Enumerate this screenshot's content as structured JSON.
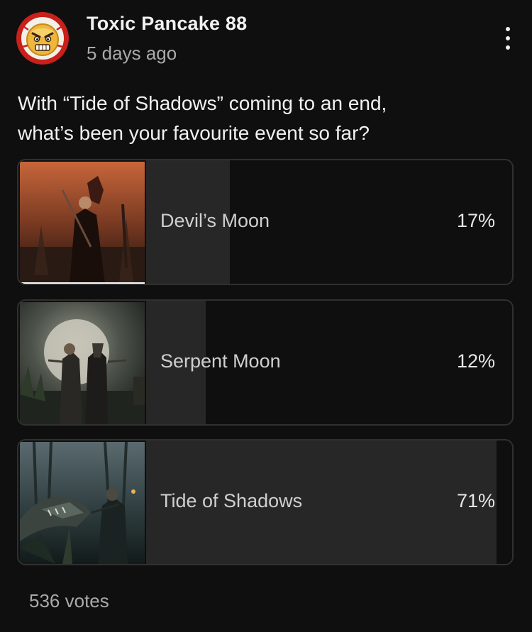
{
  "post": {
    "author": "Toxic Pancake 88",
    "time": "5 days ago",
    "question_line1": "With “Tide of Shadows” coming to an end,",
    "question_line2": "what’s been your favourite event so far?"
  },
  "poll": {
    "options": [
      {
        "label": "Devil’s Moon",
        "percent": "17%",
        "fraction": 0.17,
        "image": "devils-moon-artwork"
      },
      {
        "label": "Serpent Moon",
        "percent": "12%",
        "fraction": 0.12,
        "image": "serpent-moon-artwork"
      },
      {
        "label": "Tide of Shadows",
        "percent": "71%",
        "fraction": 0.71,
        "image": "tide-of-shadows-artwork"
      }
    ],
    "votes": "536 votes"
  },
  "icons": {
    "avatar": "angry-pancake-avatar",
    "menu": "more-vertical-icon"
  },
  "colors": {
    "background": "#0f0f0f",
    "option_border": "#303030",
    "result_fill": "#272727",
    "muted_text": "#aaaaaa"
  }
}
